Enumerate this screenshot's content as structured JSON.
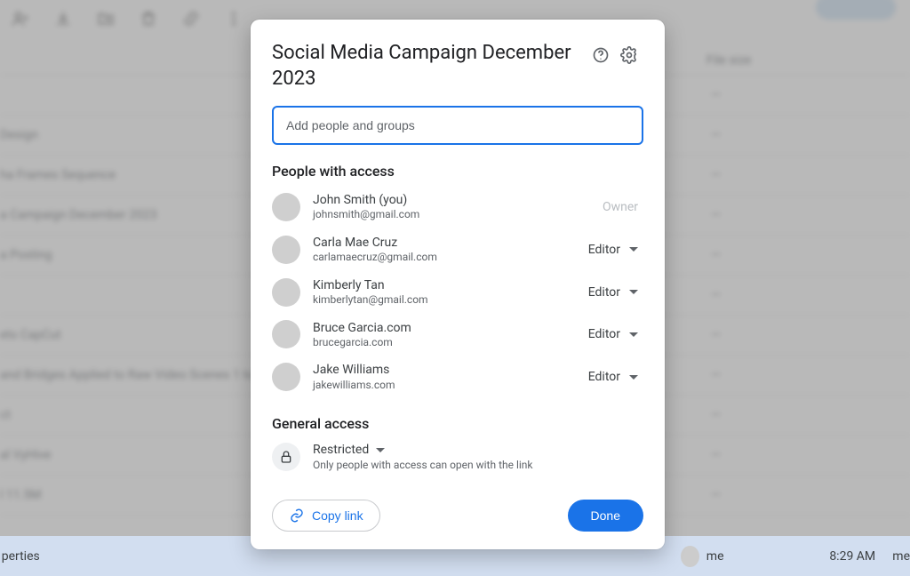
{
  "background": {
    "columns": {
      "filesize": "File size"
    },
    "rows": [
      {
        "name": "",
        "size": "—"
      },
      {
        "name": "Design",
        "size": "—"
      },
      {
        "name": "ha Frames Sequence",
        "size": "—"
      },
      {
        "name": "a Campaign December 2023",
        "size": "—"
      },
      {
        "name": "a Posting",
        "size": "—"
      },
      {
        "name": "",
        "size": "—"
      },
      {
        "name": "ets CapCut",
        "size": "—"
      },
      {
        "name": "and Bridges Applied to Raw Video Scenes 1 to",
        "size": "—"
      },
      {
        "name": "ct",
        "size": "—"
      },
      {
        "name": "al VyHive",
        "size": "—"
      },
      {
        "name": "l 11.5M",
        "size": "—"
      }
    ],
    "footer": {
      "name": "perties",
      "owner": "me",
      "time": "8:29 AM",
      "owner2": "me"
    }
  },
  "modal": {
    "title": "Social Media Campaign December 2023",
    "add_placeholder": "Add people and groups",
    "people_header": "People with access",
    "owner_label": "Owner",
    "editor_label": "Editor",
    "people": [
      {
        "name": "John Smith (you)",
        "email": "johnsmith@gmail.com",
        "role": "owner"
      },
      {
        "name": "Carla Mae Cruz",
        "email": "carlamaecruz@gmail.com",
        "role": "editor"
      },
      {
        "name": "Kimberly Tan",
        "email": "kimberlytan@gmail.com",
        "role": "editor"
      },
      {
        "name": "Bruce Garcia.com",
        "email": "brucegarcia.com",
        "role": "editor"
      },
      {
        "name": "Jake Williams",
        "email": "jakewilliams.com",
        "role": "editor"
      }
    ],
    "general_header": "General access",
    "general": {
      "mode": "Restricted",
      "desc": "Only people with access can open with the link"
    },
    "copy_label": "Copy link",
    "done_label": "Done"
  }
}
